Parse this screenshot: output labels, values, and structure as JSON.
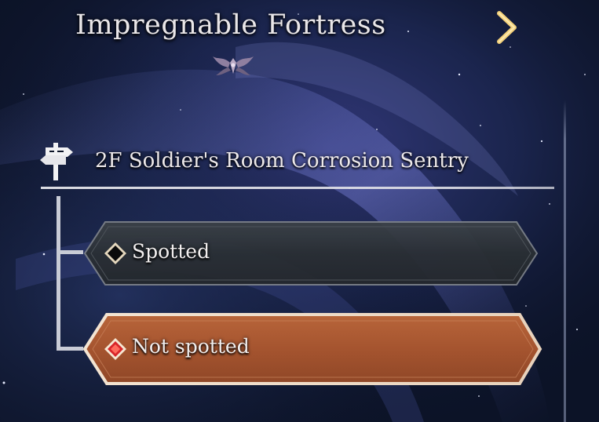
{
  "screen": {
    "title": "Impregnable Fortress",
    "location": "2F Soldier's Room Corrosion Sentry"
  },
  "icons": {
    "next": "chevron-right-icon",
    "emblem": "ornament-emblem-icon",
    "location": "signpost-icon",
    "option_1": "black-diamond-icon",
    "option_2": "red-diamond-icon"
  },
  "choices": [
    {
      "label": "Spotted"
    },
    {
      "label": "Not spotted"
    }
  ],
  "colors": {
    "background": "#0d1428",
    "accent_gold": "#e0b24a",
    "choice_dark": "#2b3034",
    "choice_highlight": "#a5542f",
    "text": "#efecec"
  }
}
